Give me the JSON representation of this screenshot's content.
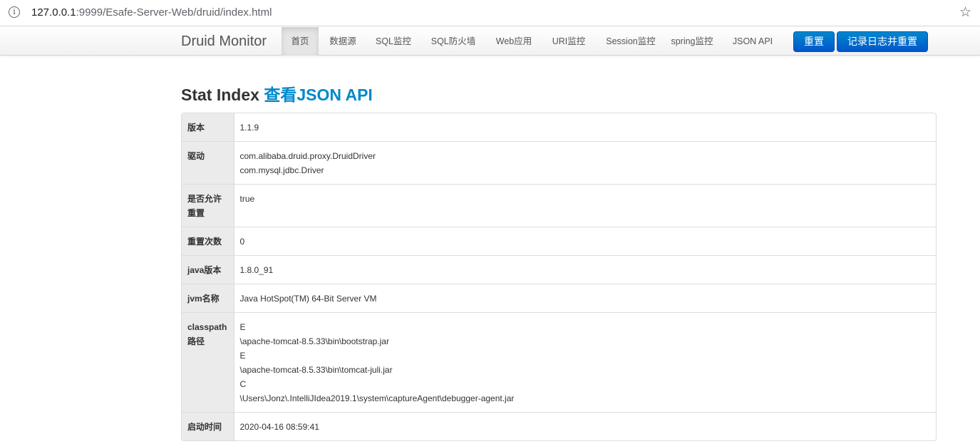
{
  "browser": {
    "url_host": "127.0.0.1",
    "url_rest": ":9999/Esafe-Server-Web/druid/index.html"
  },
  "navbar": {
    "brand": "Druid Monitor",
    "items": [
      {
        "label": "首页",
        "active": true
      },
      {
        "label": "数据源"
      },
      {
        "label": "SQL监控"
      },
      {
        "label": "SQL防火墙"
      },
      {
        "label": "Web应用"
      },
      {
        "label": "URI监控"
      },
      {
        "label": "Session监控"
      },
      {
        "label": "spring监控"
      },
      {
        "label": "JSON API"
      }
    ],
    "reset_label": "重置",
    "log_reset_label": "记录日志并重置"
  },
  "page": {
    "title": "Stat Index",
    "title_link": "查看JSON API"
  },
  "stats": {
    "rows": [
      {
        "key": "版本",
        "values": [
          "1.1.9"
        ]
      },
      {
        "key": "驱动",
        "values": [
          "com.alibaba.druid.proxy.DruidDriver",
          "com.mysql.jdbc.Driver"
        ]
      },
      {
        "key": "是否允许重置",
        "values": [
          "true"
        ]
      },
      {
        "key": "重置次数",
        "values": [
          "0"
        ]
      },
      {
        "key": "java版本",
        "values": [
          "1.8.0_91"
        ]
      },
      {
        "key": "jvm名称",
        "values": [
          "Java HotSpot(TM) 64-Bit Server VM"
        ]
      },
      {
        "key": "classpath路径",
        "values": [
          "E",
          "\\apache-tomcat-8.5.33\\bin\\bootstrap.jar",
          "E",
          "\\apache-tomcat-8.5.33\\bin\\tomcat-juli.jar",
          "C",
          "\\Users\\Jonz\\.IntelliJIdea2019.1\\system\\captureAgent\\debugger-agent.jar"
        ]
      },
      {
        "key": "启动时间",
        "values": [
          "2020-04-16 08:59:41"
        ]
      }
    ]
  }
}
